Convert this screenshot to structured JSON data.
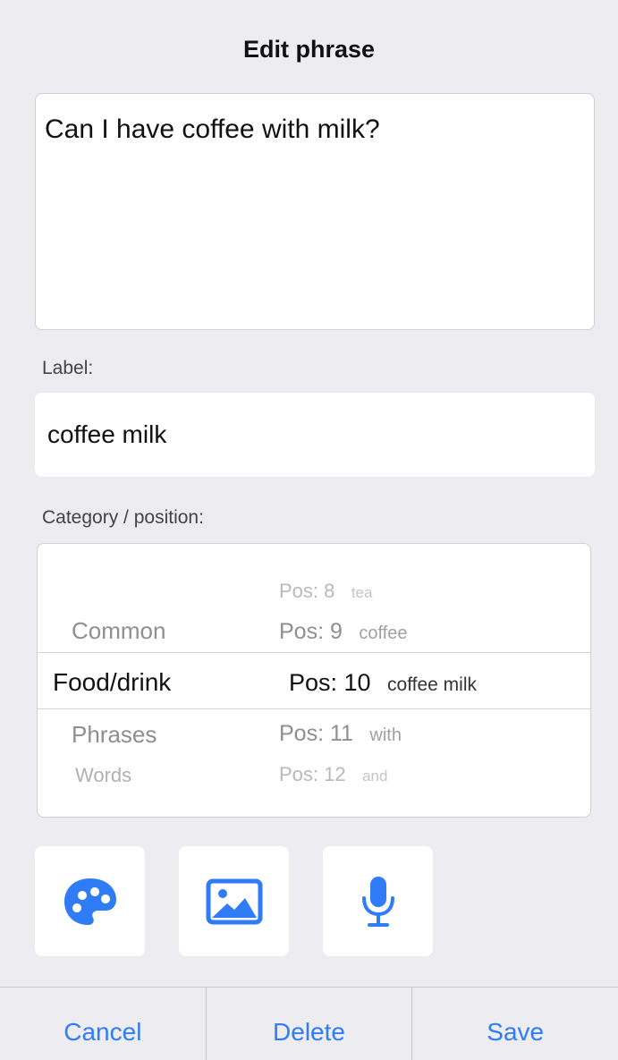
{
  "title": "Edit phrase",
  "phrase_text": "Can I have coffee with milk?",
  "label_caption": "Label:",
  "label_value": "coffee milk",
  "category_caption": "Category / position:",
  "picker": {
    "categories": [
      {
        "text": "Common",
        "state": "near"
      },
      {
        "text": "Food/drink",
        "state": "selected"
      },
      {
        "text": "Phrases",
        "state": "near"
      },
      {
        "text": "Words",
        "state": "far"
      }
    ],
    "positions": [
      {
        "pos": "Pos: 8",
        "word": "tea"
      },
      {
        "pos": "Pos: 9",
        "word": "coffee"
      },
      {
        "pos": "Pos: 10",
        "word": "coffee milk"
      },
      {
        "pos": "Pos: 11",
        "word": "with"
      },
      {
        "pos": "Pos: 12",
        "word": "and"
      }
    ]
  },
  "tools": [
    {
      "name": "palette-icon"
    },
    {
      "name": "image-icon"
    },
    {
      "name": "microphone-icon"
    }
  ],
  "buttons": {
    "cancel": "Cancel",
    "delete": "Delete",
    "save": "Save"
  },
  "colors": {
    "accent": "#2f7cf6",
    "background": "#ececf1"
  }
}
